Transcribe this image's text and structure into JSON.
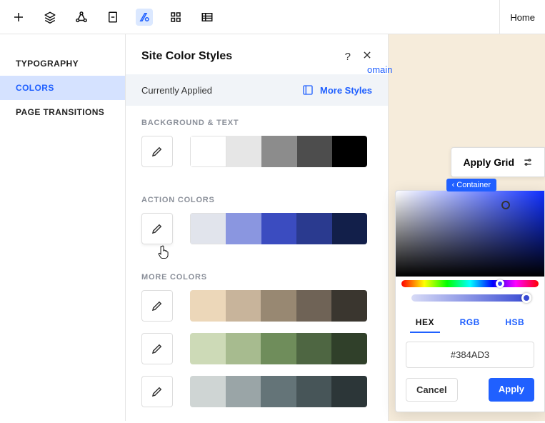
{
  "toolbar": {
    "icons": [
      "plus",
      "layers",
      "share",
      "page",
      "styles",
      "apps",
      "table"
    ]
  },
  "home_label": "Home",
  "sidebar": {
    "items": [
      {
        "label": "TYPOGRAPHY"
      },
      {
        "label": "COLORS"
      },
      {
        "label": "PAGE TRANSITIONS"
      }
    ]
  },
  "panel": {
    "title": "Site Color Styles",
    "applied_label": "Currently Applied",
    "more_styles_label": "More Styles",
    "sections": {
      "bg_text": {
        "title": "BACKGROUND & TEXT",
        "colors": [
          "#ffffff",
          "#e6e6e6",
          "#8c8c8c",
          "#4d4d4d",
          "#000000"
        ]
      },
      "action": {
        "title": "ACTION COLORS",
        "colors": [
          "#e1e4ec",
          "#8a96e0",
          "#3b4cc0",
          "#2a3a8f",
          "#121f4a"
        ]
      },
      "more": {
        "title": "MORE COLORS",
        "rows": [
          [
            "#ecd7b9",
            "#c8b49b",
            "#988872",
            "#6f6356",
            "#3a362f"
          ],
          [
            "#cddab7",
            "#a7bb8f",
            "#6f8d5b",
            "#4e6642",
            "#30402a"
          ],
          [
            "#cfd5d4",
            "#9aa5a7",
            "#647478",
            "#475558",
            "#2c3638"
          ]
        ]
      }
    }
  },
  "canvas": {
    "domain_link": "omain",
    "apply_grid_label": "Apply Grid",
    "container_label": "Container"
  },
  "color_picker": {
    "modes": [
      "HEX",
      "RGB",
      "HSB"
    ],
    "hex_value": "#384AD3",
    "cancel_label": "Cancel",
    "apply_label": "Apply"
  }
}
